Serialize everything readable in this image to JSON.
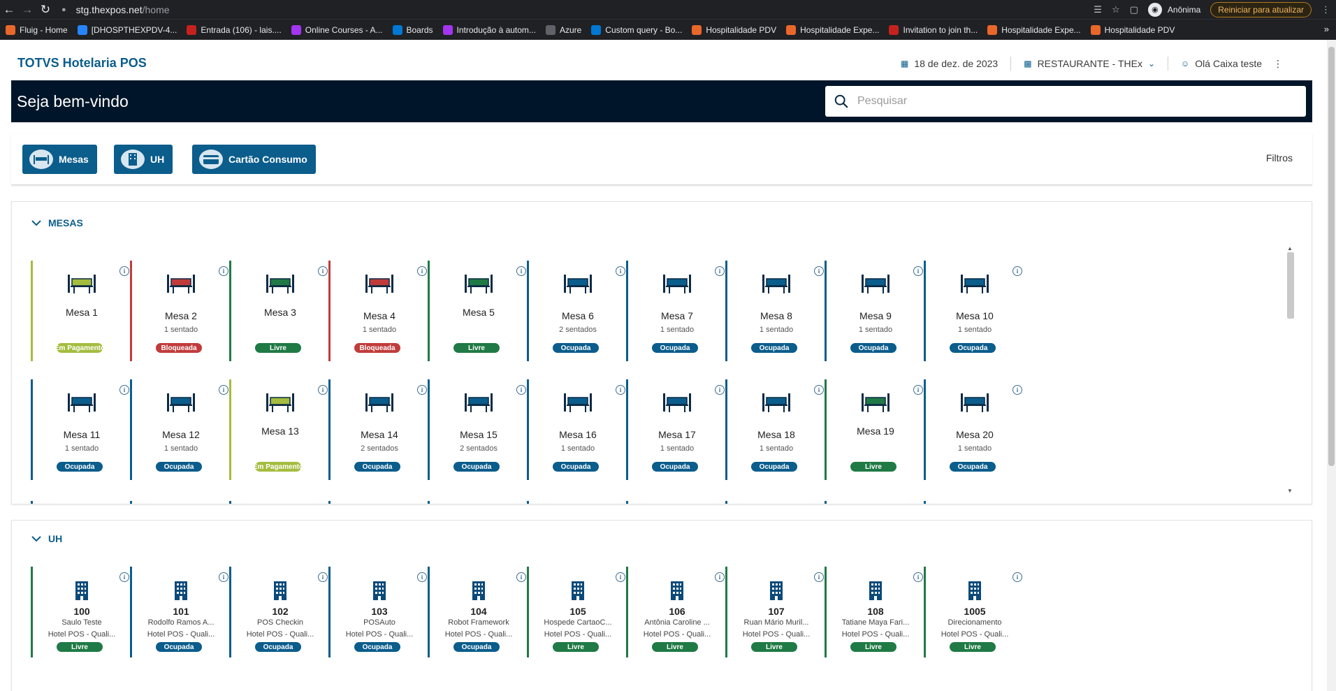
{
  "browser": {
    "url_host": "stg.thexpos.net",
    "url_path": "/home",
    "profile_label": "Anônima",
    "restart_label": "Reiniciar para atualizar",
    "bookmarks": [
      {
        "label": "Fluig - Home",
        "icon": "fluig-icon",
        "color": "#e9672b"
      },
      {
        "label": "[DHOSPTHEXPDV-4...",
        "icon": "jira-icon",
        "color": "#2684ff"
      },
      {
        "label": "Entrada (106) - lais....",
        "icon": "mail-icon",
        "color": "#c5221f"
      },
      {
        "label": "Online Courses - A...",
        "icon": "udemy-icon",
        "color": "#a435f0"
      },
      {
        "label": "Boards",
        "icon": "azure-boards-icon",
        "color": "#0078d4"
      },
      {
        "label": "Introdução à autom...",
        "icon": "udemy-icon",
        "color": "#a435f0"
      },
      {
        "label": "Azure",
        "icon": "globe-icon",
        "color": "#5f6368"
      },
      {
        "label": "Custom query - Bo...",
        "icon": "azure-boards-icon",
        "color": "#0078d4"
      },
      {
        "label": "Hospitalidade PDV",
        "icon": "pos-icon",
        "color": "#e9672b"
      },
      {
        "label": "Hospitalidade Expe...",
        "icon": "pos-icon",
        "color": "#e9672b"
      },
      {
        "label": "Invitation to join th...",
        "icon": "mail-icon",
        "color": "#c5221f"
      },
      {
        "label": "Hospitalidade Expe...",
        "icon": "pos-icon",
        "color": "#e9672b"
      },
      {
        "label": "Hospitalidade PDV",
        "icon": "pos-icon",
        "color": "#e9672b"
      }
    ]
  },
  "header": {
    "brand": "TOTVS Hotelaria POS",
    "date": "18 de dez. de 2023",
    "location": "RESTAURANTE - THEx",
    "user": "Olá Caixa teste"
  },
  "welcome": {
    "title": "Seja bem-vindo",
    "search_placeholder": "Pesquisar"
  },
  "filterbar": {
    "buttons": [
      {
        "label": "Mesas",
        "icon": "table-icon"
      },
      {
        "label": "UH",
        "icon": "building-icon"
      },
      {
        "label": "Cartão Consumo",
        "icon": "card-icon"
      }
    ],
    "filters_label": "Filtros"
  },
  "colors": {
    "Em Pagamento": "#a4bd3f",
    "Bloqueada": "#c23b3b",
    "Livre": "#1f7a45",
    "Ocupada": "#0b5d8c"
  },
  "mesas": {
    "title": "MESAS",
    "items": [
      {
        "name": "Mesa 1",
        "seats": "",
        "status": "Em Pagamento"
      },
      {
        "name": "Mesa 2",
        "seats": "1 sentado",
        "status": "Bloqueada"
      },
      {
        "name": "Mesa 3",
        "seats": "",
        "status": "Livre"
      },
      {
        "name": "Mesa 4",
        "seats": "1 sentado",
        "status": "Bloqueada"
      },
      {
        "name": "Mesa 5",
        "seats": "",
        "status": "Livre"
      },
      {
        "name": "Mesa 6",
        "seats": "2 sentados",
        "status": "Ocupada"
      },
      {
        "name": "Mesa 7",
        "seats": "1 sentado",
        "status": "Ocupada"
      },
      {
        "name": "Mesa 8",
        "seats": "1 sentado",
        "status": "Ocupada"
      },
      {
        "name": "Mesa 9",
        "seats": "1 sentado",
        "status": "Ocupada"
      },
      {
        "name": "Mesa 10",
        "seats": "1 sentado",
        "status": "Ocupada"
      },
      {
        "name": "Mesa 11",
        "seats": "1 sentado",
        "status": "Ocupada"
      },
      {
        "name": "Mesa 12",
        "seats": "1 sentado",
        "status": "Ocupada"
      },
      {
        "name": "Mesa 13",
        "seats": "",
        "status": "Em Pagamento"
      },
      {
        "name": "Mesa 14",
        "seats": "2 sentados",
        "status": "Ocupada"
      },
      {
        "name": "Mesa 15",
        "seats": "2 sentados",
        "status": "Ocupada"
      },
      {
        "name": "Mesa 16",
        "seats": "1 sentado",
        "status": "Ocupada"
      },
      {
        "name": "Mesa 17",
        "seats": "1 sentado",
        "status": "Ocupada"
      },
      {
        "name": "Mesa 18",
        "seats": "1 sentado",
        "status": "Ocupada"
      },
      {
        "name": "Mesa 19",
        "seats": "",
        "status": "Livre"
      },
      {
        "name": "Mesa 20",
        "seats": "1 sentado",
        "status": "Ocupada"
      }
    ]
  },
  "uh": {
    "title": "UH",
    "items": [
      {
        "number": "100",
        "guest": "Saulo Teste",
        "hotel": "Hotel POS - Quali...",
        "status": "Livre"
      },
      {
        "number": "101",
        "guest": "Rodolfo Ramos A...",
        "hotel": "Hotel POS - Quali...",
        "status": "Ocupada"
      },
      {
        "number": "102",
        "guest": "POS Checkin",
        "hotel": "Hotel POS - Quali...",
        "status": "Ocupada"
      },
      {
        "number": "103",
        "guest": "POSAuto",
        "hotel": "Hotel POS - Quali...",
        "status": "Ocupada"
      },
      {
        "number": "104",
        "guest": "Robot Framework",
        "hotel": "Hotel POS - Quali...",
        "status": "Ocupada"
      },
      {
        "number": "105",
        "guest": "Hospede CartaoC...",
        "hotel": "Hotel POS - Quali...",
        "status": "Livre"
      },
      {
        "number": "106",
        "guest": "Antônia Caroline ...",
        "hotel": "Hotel POS - Quali...",
        "status": "Livre"
      },
      {
        "number": "107",
        "guest": "Ruan Mário Muril...",
        "hotel": "Hotel POS - Quali...",
        "status": "Livre"
      },
      {
        "number": "108",
        "guest": "Tatiane Maya Fari...",
        "hotel": "Hotel POS - Quali...",
        "status": "Livre"
      },
      {
        "number": "1005",
        "guest": "Direcionamento",
        "hotel": "Hotel POS - Quali...",
        "status": "Livre"
      }
    ]
  }
}
